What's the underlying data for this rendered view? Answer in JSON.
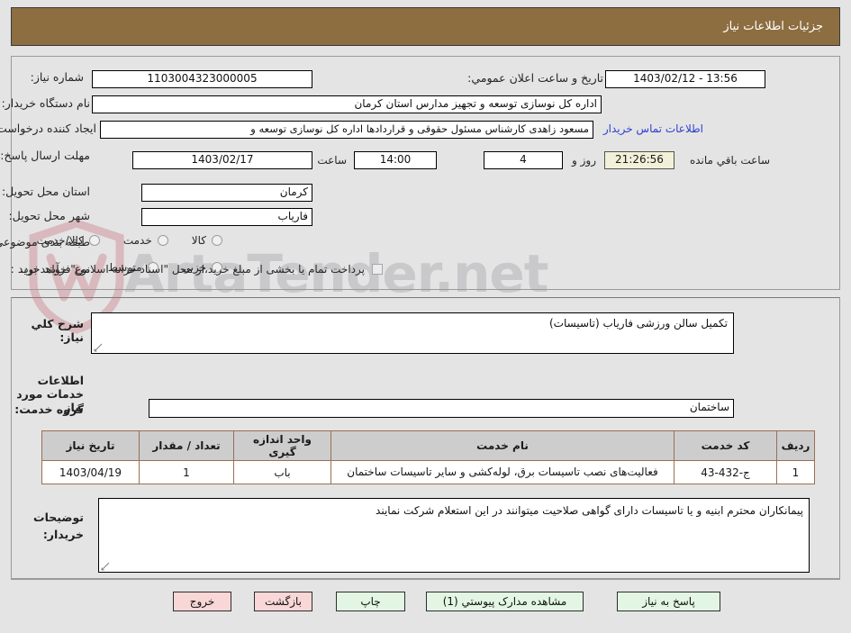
{
  "header": {
    "title": "جزئیات اطلاعات نیاز",
    "bg_color": "#8d6e41"
  },
  "form": {
    "need_number": {
      "label": "شماره نیاز:",
      "value": "1103004323000005"
    },
    "public_announce": {
      "label": "تاریخ و ساعت اعلان عمومي:",
      "value": "13:56 - 1403/02/12"
    },
    "buyer_org": {
      "label": "نام دستگاه خریدار:",
      "value": "اداره کل نوسازی  توسعه و تجهیز مدارس استان کرمان"
    },
    "requester": {
      "label": "ایجاد کننده درخواست:",
      "value": "مسعود زاهدی کارشناس مسئول حقوقی و قراردادها اداره کل نوسازی  توسعه و",
      "contact_link": "اطلاعات تماس خریدار"
    },
    "deadline": {
      "label": "مهلت ارسال پاسخ: تا تاریخ:",
      "date": "1403/02/17",
      "time_label": "ساعت",
      "time": "14:00",
      "days": "4",
      "days_label": "روز و",
      "countdown": "21:26:56",
      "remaining_label": "ساعت باقي مانده"
    },
    "province": {
      "label": "استان محل تحویل:",
      "value": "کرمان"
    },
    "city": {
      "label": "شهر محل تحویل:",
      "value": "فاریاب"
    },
    "category": {
      "label": "طبقه بندی موضوعی:",
      "options": [
        {
          "label": "کالا",
          "selected": false
        },
        {
          "label": "خدمت",
          "selected": false
        },
        {
          "label": "کالا/خدمت",
          "selected": false
        }
      ]
    },
    "purchase_type": {
      "label": "نوع فرآیند خرید :",
      "options": [
        {
          "label": "جزیي",
          "selected": false
        },
        {
          "label": "متوسط",
          "selected": false
        }
      ],
      "treasury_checkbox": {
        "checked": false,
        "label": "پرداخت تمام یا بخشی از مبلغ خرید،از محل \"اسناد خزانه اسلامی\" خواهد بود."
      }
    },
    "general_desc": {
      "label": "شرح کلي نیاز:",
      "value": "تکمیل سالن ورزشی فاریاب (تاسیسات)"
    },
    "services_section_title": "اطلاعات خدمات مورد نیاز",
    "service_group": {
      "label": "گروه خدمت:",
      "value": "ساختمان"
    },
    "buyer_notes": {
      "label": "توضیحات خریدار:",
      "value": "پیمانکاران محترم ابنیه و یا تاسیسات دارای گواهی صلاحیت میتوانند در این استعلام شرکت نمایند"
    }
  },
  "table": {
    "columns": [
      "ردیف",
      "کد خدمت",
      "نام خدمت",
      "واحد اندازه گیری",
      "تعداد / مقدار",
      "تاریخ نیاز"
    ],
    "rows": [
      {
        "row_no": "1",
        "service_code": "ج-432-43",
        "service_name": "فعالیت‌های نصب تاسیسات برق، لوله‌کشی و سایر تاسیسات ساختمان",
        "unit": "باب",
        "quantity": "1",
        "need_date": "1403/04/19"
      }
    ]
  },
  "buttons": [
    {
      "label": "پاسخ به نیاز",
      "style": "green"
    },
    {
      "label": "مشاهده مدارک پیوستي (1)",
      "style": "green"
    },
    {
      "label": "چاپ",
      "style": "green"
    },
    {
      "label": "بازگشت",
      "style": "red"
    },
    {
      "label": "خروج",
      "style": "red"
    }
  ],
  "watermark": {
    "text": "ArtaTender.net"
  }
}
